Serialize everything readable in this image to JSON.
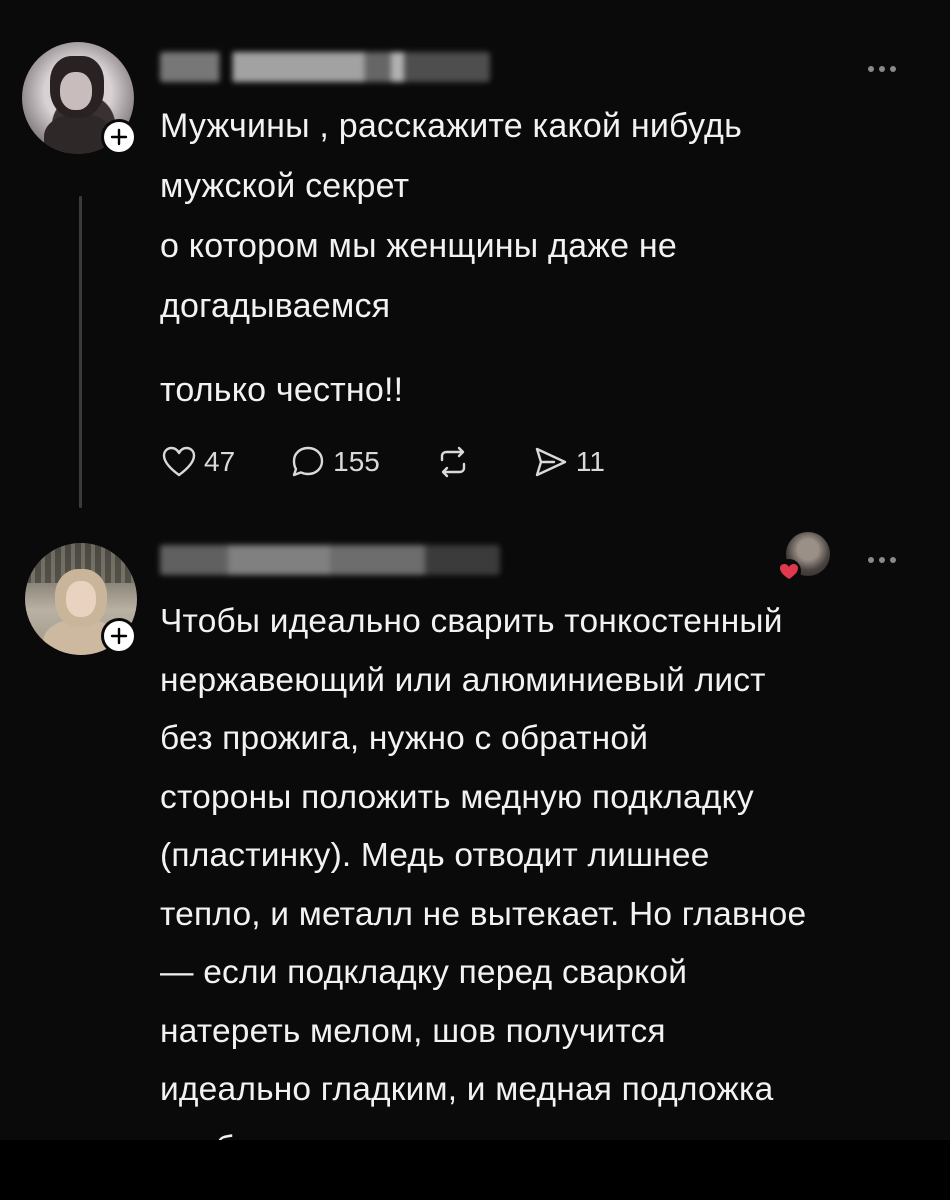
{
  "post": {
    "lines": [
      "Мужчины , расскажите какой нибудь",
      "мужской секрет",
      "о котором мы женщины  даже не",
      "догадываемся",
      "только честно!!"
    ],
    "actions": {
      "likes": "47",
      "comments": "155",
      "shares": "11"
    }
  },
  "reply": {
    "lines": [
      "Чтобы идеально сварить тонкостенный",
      "нержавеющий или алюминиевый лист",
      "без прожига, нужно с обратной",
      "стороны положить медную подкладку",
      "(пластинку). Медь отводит лишнее",
      "тепло, и металл не вытекает. Но главное",
      "— если подкладку перед сваркой",
      "натереть мелом, шов получится",
      "идеально гладким, и медная подложка",
      "вообще не прилипнет."
    ]
  },
  "icons": {
    "like": "heart-icon",
    "comment": "comment-bubble-icon",
    "repost": "repost-icon",
    "share": "send-icon",
    "more": "more-dots-icon",
    "follow": "plus-icon"
  },
  "colors": {
    "background": "#0a0a0a",
    "text": "#f2f2f2",
    "muted": "#8a8a8a",
    "heart": "#e0384f"
  }
}
